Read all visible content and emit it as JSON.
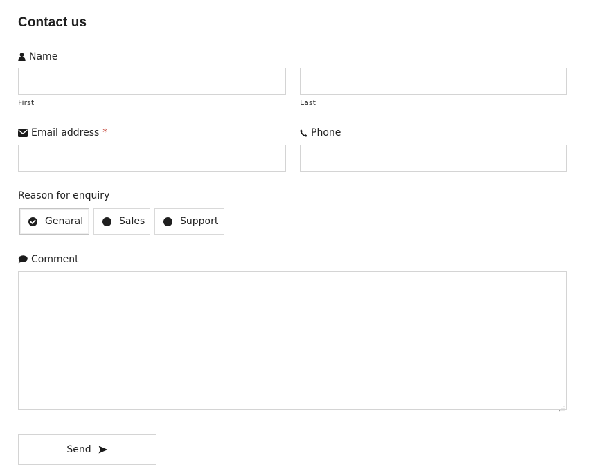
{
  "form": {
    "title": "Contact us"
  },
  "name": {
    "label": "Name",
    "icon": "user-icon",
    "first": {
      "value": "",
      "sublabel": "First"
    },
    "last": {
      "value": "",
      "sublabel": "Last"
    }
  },
  "email": {
    "label": "Email address",
    "icon": "envelope-icon",
    "required_mark": "*",
    "value": ""
  },
  "phone": {
    "label": "Phone",
    "icon": "phone-icon",
    "value": ""
  },
  "reason": {
    "label": "Reason for enquiry",
    "options": [
      {
        "label": "Genaral",
        "selected": true
      },
      {
        "label": "Sales",
        "selected": false
      },
      {
        "label": "Support",
        "selected": false
      }
    ]
  },
  "comment": {
    "label": "Comment",
    "icon": "comment-icon",
    "value": ""
  },
  "submit": {
    "label": "Send",
    "icon": "send-arrow-icon"
  },
  "colors": {
    "required": "#c0392b",
    "border": "#d4d4d4",
    "text": "#222222"
  }
}
